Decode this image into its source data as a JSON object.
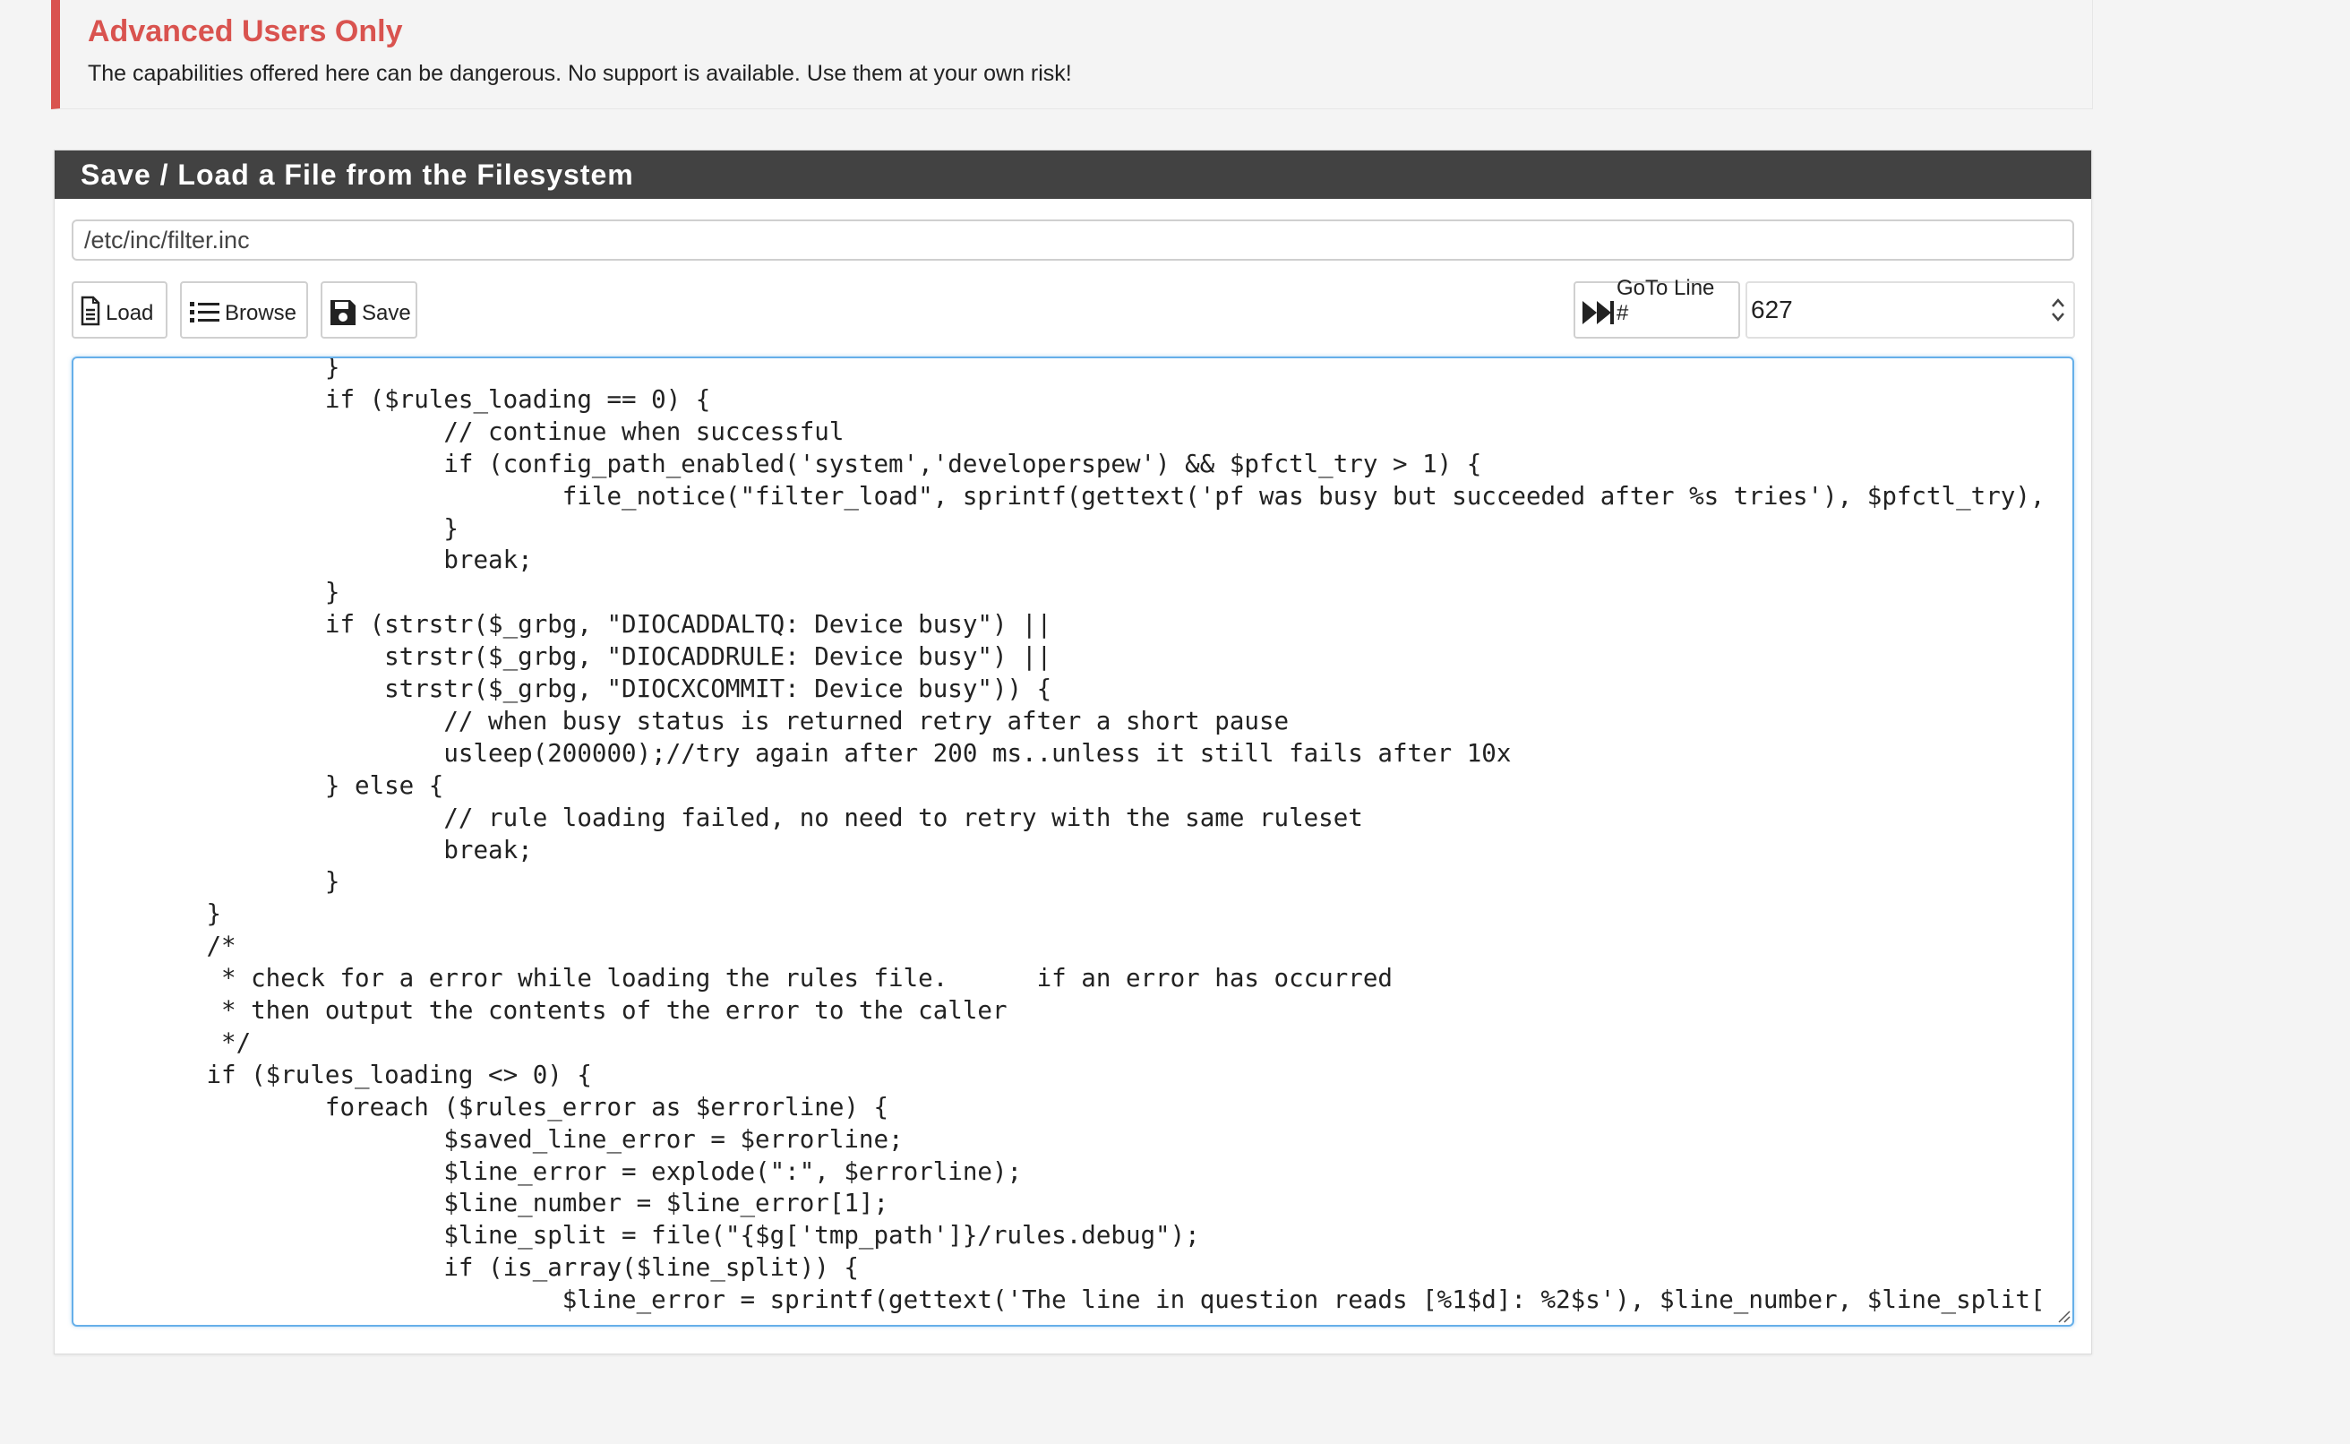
{
  "alert": {
    "title": "Advanced Users Only",
    "text": "The capabilities offered here can be dangerous. No support is available. Use them at your own risk!"
  },
  "panel": {
    "title": "Save / Load a File from the Filesystem",
    "file_path": "/etc/inc/filter.inc",
    "buttons": {
      "load": "Load",
      "browse": "Browse",
      "save": "Save",
      "goto": "GoTo Line #"
    },
    "goto_line": "627"
  },
  "colors": {
    "alert_accent": "#d9534f",
    "panel_heading_bg": "#424242",
    "editor_focus_border": "#66afe9"
  },
  "editor": {
    "lines": [
      "                }",
      "                if ($rules_loading == 0) {",
      "                        // continue when successful",
      "                        if (config_path_enabled('system','developerspew') && $pfctl_try > 1) {",
      "                                file_notice(\"filter_load\", sprintf(gettext('pf was busy but succeeded after %s tries'), $pfctl_try),",
      "                        }",
      "                        break;",
      "                }",
      "                if (strstr($_grbg, \"DIOCADDALTQ: Device busy\") ||",
      "                    strstr($_grbg, \"DIOCADDRULE: Device busy\") ||",
      "                    strstr($_grbg, \"DIOCXCOMMIT: Device busy\")) {",
      "                        // when busy status is returned retry after a short pause",
      "                        usleep(200000);//try again after 200 ms..unless it still fails after 10x",
      "                } else {",
      "                        // rule loading failed, no need to retry with the same ruleset",
      "                        break;",
      "                }",
      "        }",
      "        /*",
      "         * check for a error while loading the rules file.      if an error has occurred",
      "         * then output the contents of the error to the caller",
      "         */",
      "        if ($rules_loading <> 0) {",
      "                foreach ($rules_error as $errorline) {",
      "                        $saved_line_error = $errorline;",
      "                        $line_error = explode(\":\", $errorline);",
      "                        $line_number = $line_error[1];",
      "                        $line_split = file(\"{$g['tmp_path']}/rules.debug\");",
      "                        if (is_array($line_split)) {",
      "                                $line_error = sprintf(gettext('The line in question reads [%1$d]: %2$s'), $line_number, $line_split["
    ]
  }
}
